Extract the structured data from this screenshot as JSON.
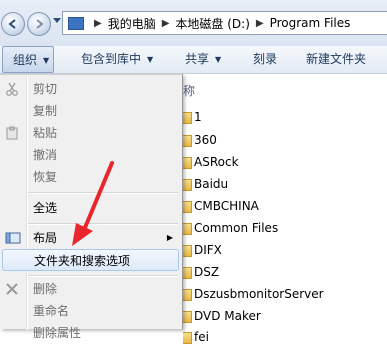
{
  "address": {
    "crumbs": [
      "我的电脑",
      "本地磁盘 (D:)",
      "Program Files"
    ],
    "separator": "▶"
  },
  "toolbar": {
    "organize": "组织",
    "include_library": "包含到库中",
    "share": "共享",
    "burn": "刻录",
    "new_folder": "新建文件夹"
  },
  "filelist": {
    "name_header_partial": "称",
    "folders": [
      "1",
      "360",
      "ASRock",
      "Baidu",
      "CMBCHINA",
      "Common Files",
      "DIFX",
      "DSZ",
      "DszusbmonitorServer",
      "DVD Maker",
      "fei"
    ]
  },
  "menu": {
    "cut": "剪切",
    "copy": "复制",
    "paste": "粘贴",
    "undo": "撤消",
    "redo": "恢复",
    "select_all": "全选",
    "layout": "布局",
    "folder_options": "文件夹和搜索选项",
    "delete": "删除",
    "rename": "重命名",
    "remove_properties": "删除属性"
  },
  "colors": {
    "annotation_arrow": "#e8262b",
    "toolbar_text": "#1e395b",
    "highlight_border": "#a8c8f0"
  },
  "icons": [
    "back-arrow-icon",
    "forward-arrow-icon",
    "scissors-icon",
    "paste-icon",
    "layout-icon",
    "delete-x-icon"
  ]
}
